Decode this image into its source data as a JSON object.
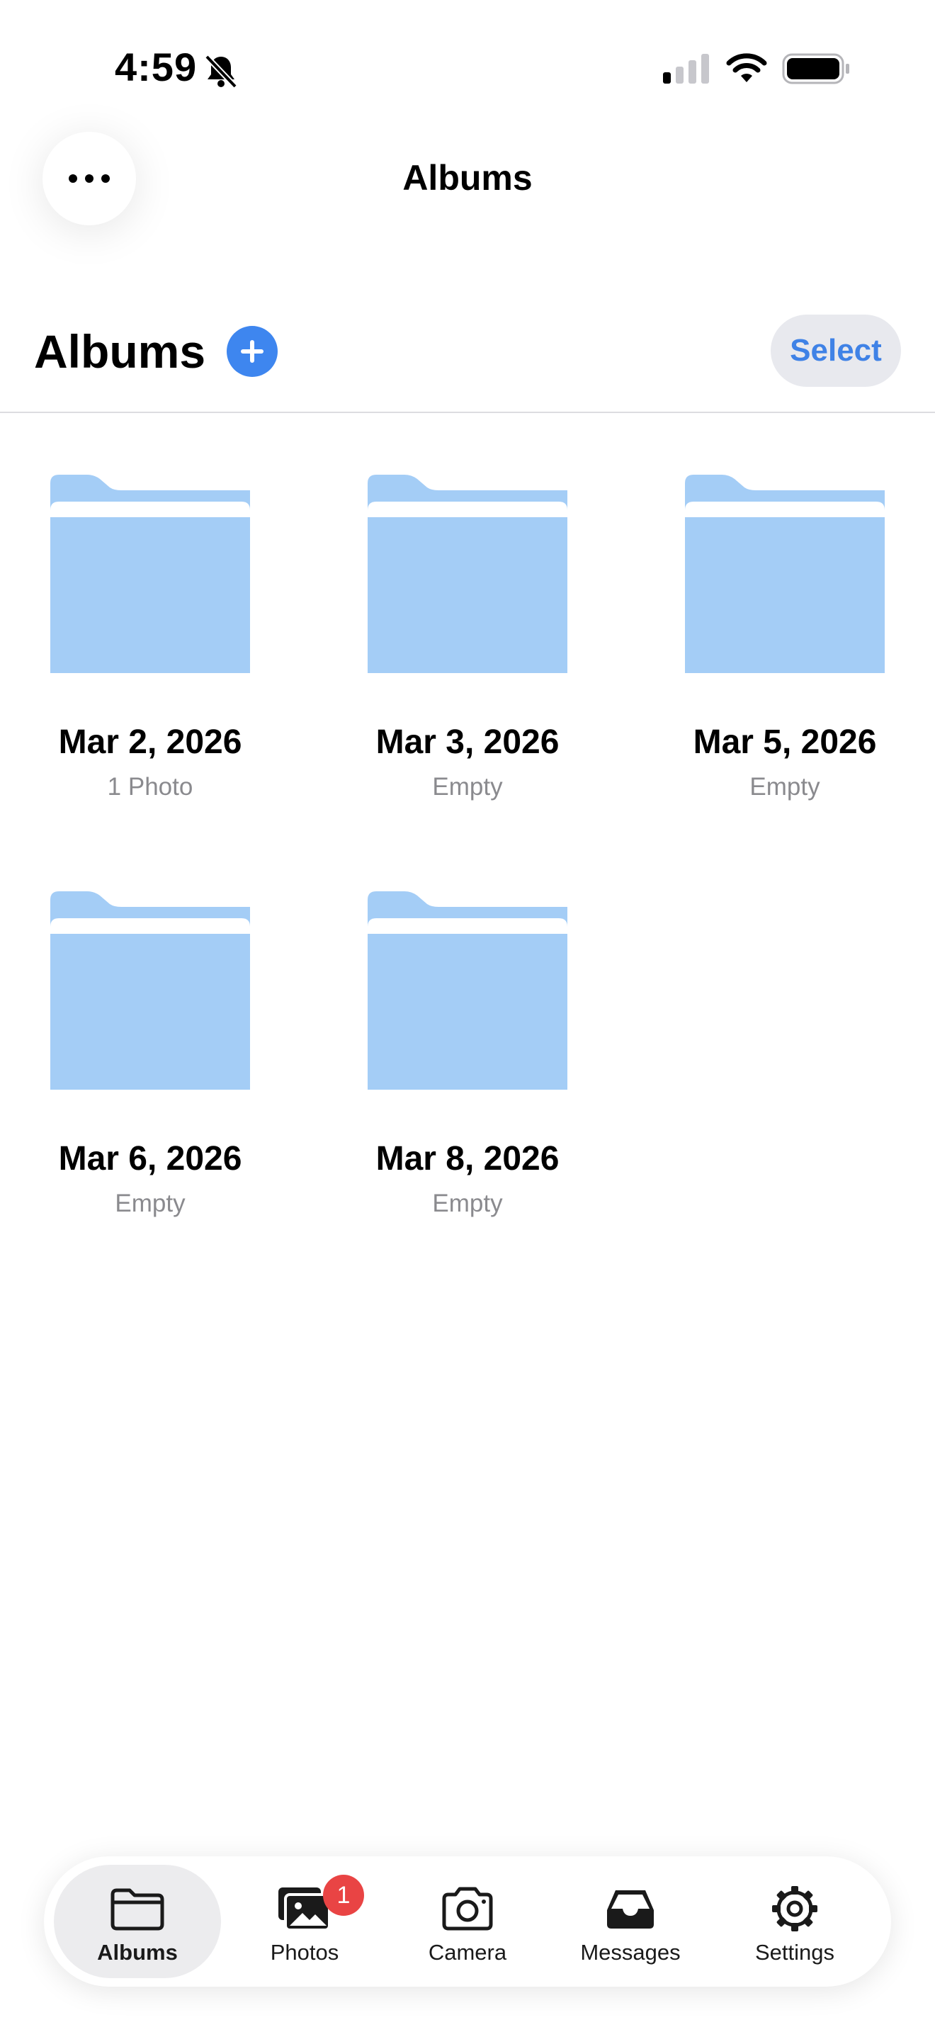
{
  "status_bar": {
    "time": "4:59"
  },
  "nav": {
    "title": "Albums",
    "more_icon": "ellipsis-icon"
  },
  "header": {
    "title": "Albums",
    "add_icon": "plus-icon",
    "select_label": "Select"
  },
  "albums": [
    {
      "title": "Mar 2, 2026",
      "subtitle": "1 Photo"
    },
    {
      "title": "Mar 3, 2026",
      "subtitle": "Empty"
    },
    {
      "title": "Mar 5, 2026",
      "subtitle": "Empty"
    },
    {
      "title": "Mar 6, 2026",
      "subtitle": "Empty"
    },
    {
      "title": "Mar 8, 2026",
      "subtitle": "Empty"
    }
  ],
  "tab_bar": {
    "tabs": [
      {
        "label": "Albums",
        "icon": "folder-icon",
        "active": true
      },
      {
        "label": "Photos",
        "icon": "photos-icon",
        "badge": "1"
      },
      {
        "label": "Camera",
        "icon": "camera-icon"
      },
      {
        "label": "Messages",
        "icon": "inbox-icon"
      },
      {
        "label": "Settings",
        "icon": "gear-icon"
      }
    ]
  },
  "colors": {
    "accent": "#3e86ef",
    "select_text": "#3f82e6",
    "select_bg": "#e8e9ee",
    "folder": "#a4cdf6",
    "badge": "#e94444",
    "secondary_text": "#8a8a8e"
  }
}
